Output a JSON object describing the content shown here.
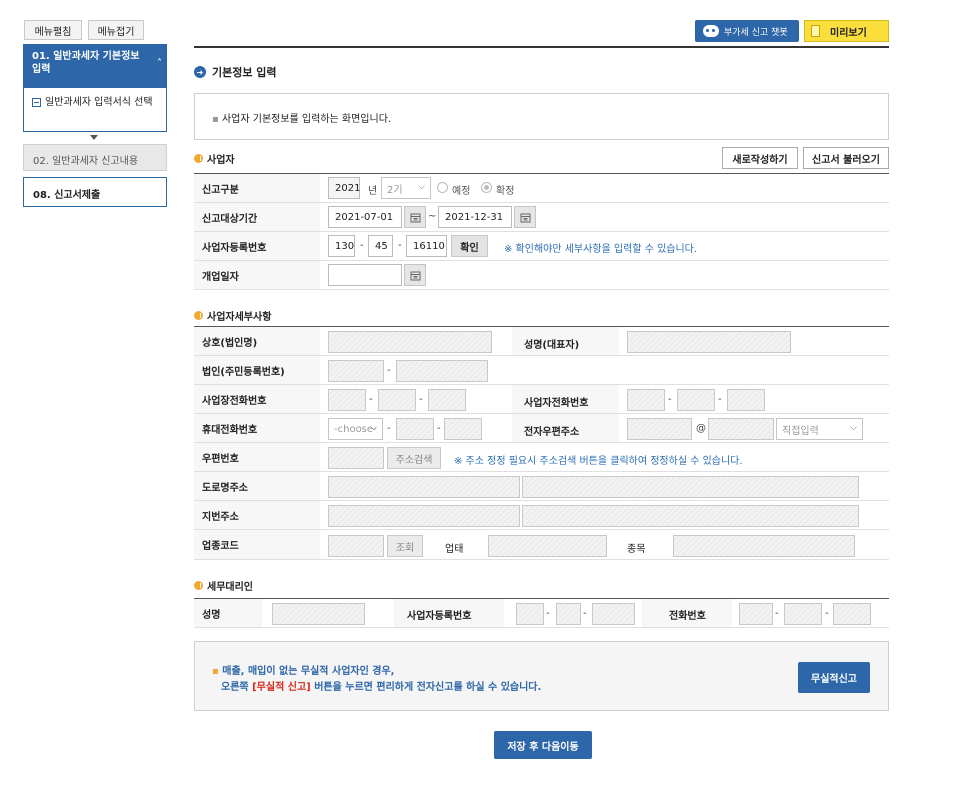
{
  "sidebar": {
    "expand_label": "메뉴펼침",
    "collapse_label": "메뉴접기",
    "step1": "01. 일반과세자 기본정보 입력",
    "step1_sub": "일반과세자 입력서식 선택",
    "step2": "02. 일반과세자 신고내용",
    "step8": "08. 신고서제출"
  },
  "header": {
    "chatbot_label": "부가세 신고 챗봇",
    "preview_label": "미리보기",
    "page_title": "기본정보 입력",
    "info_text": "사업자 기본정보를 입력하는 화면입니다."
  },
  "business": {
    "section_title": "사업자",
    "new_button": "새로작성하기",
    "load_button": "신고서 불러오기",
    "report_type_label": "신고구분",
    "year": "2021",
    "year_unit": "년",
    "period": "2기",
    "radio_planned": "예정",
    "radio_final": "확정",
    "target_period_label": "신고대상기간",
    "start_date": "2021-07-01",
    "tilde": "~",
    "end_date": "2021-12-31",
    "reg_no_label": "사업자등록번호",
    "reg1": "130",
    "reg2": "45",
    "reg3": "16110",
    "confirm_button": "확인",
    "reg_note": "※ 확인해야만 세부사항을 입력할 수 있습니다.",
    "open_date_label": "개업일자"
  },
  "details": {
    "section_title": "사업자세부사항",
    "trade_name_label": "상호(법인명)",
    "rep_name_label": "성명(대표자)",
    "corp_no_label": "법인(주민등록번호)",
    "office_phone_label": "사업장전화번호",
    "biz_phone_label": "사업자전화번호",
    "mobile_label": "휴대전화번호",
    "mobile_select": "-choose-",
    "email_label": "전자우편주소",
    "at": "@",
    "email_select": "직접입력",
    "zip_label": "우편번호",
    "zip_button": "주소검색",
    "zip_note": "※ 주소 정정 필요시 주소검색 버튼을 클릭하여 정정하실 수 있습니다.",
    "road_label": "도로명주소",
    "jibun_label": "지번주소",
    "industry_label": "업종코드",
    "lookup_button": "조회",
    "biz_type_label": "업태",
    "item_label": "종목"
  },
  "agent": {
    "section_title": "세무대리인",
    "name_label": "성명",
    "reg_label": "사업자등록번호",
    "phone_label": "전화번호"
  },
  "notice": {
    "line1": "매출, 매입이 없는 무실적 사업자인 경우,",
    "line2_a": "오른쪽",
    "line2_b": "[무실적 신고]",
    "line2_c": "버튼을 누르면 편리하게 전자신고를 하실 수 있습니다.",
    "button": "무실적신고"
  },
  "footer": {
    "next_button": "저장 후 다음이동"
  },
  "colors": {
    "primary": "#2d66a9",
    "accent_orange": "#f0a830",
    "preview_yellow": "#f9de3c",
    "note_blue": "#2a6db3",
    "red": "#d9261c"
  }
}
